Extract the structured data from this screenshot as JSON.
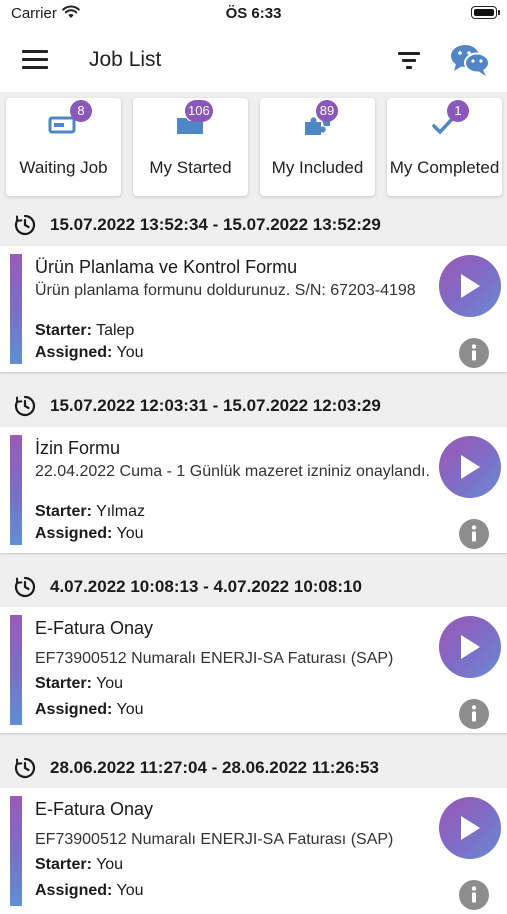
{
  "status_bar": {
    "carrier": "Carrier",
    "time": "ÖS 6:33"
  },
  "header": {
    "title": "Job List"
  },
  "tiles": [
    {
      "label": "Waiting Job",
      "badge": "8",
      "icon": "waiting-job-icon"
    },
    {
      "label": "My Started",
      "badge": "106",
      "icon": "folder-icon"
    },
    {
      "label": "My Included",
      "badge": "89",
      "icon": "puzzle-icon"
    },
    {
      "label": "My Completed",
      "badge": "1",
      "icon": "checkmark-icon"
    }
  ],
  "groups": [
    {
      "date_range": "15.07.2022 13:52:34 - 15.07.2022 13:52:29",
      "job": {
        "title": "Ürün Planlama ve Kontrol Formu",
        "description": "Ürün planlama formunu doldurunuz. S/N: 67203-4198",
        "starter_label": "Starter:",
        "starter": "Talep",
        "assigned_label": "Assigned:",
        "assigned": "You"
      }
    },
    {
      "date_range": "15.07.2022 12:03:31 - 15.07.2022 12:03:29",
      "job": {
        "title": "İzin Formu",
        "description": "22.04.2022 Cuma - 1 Günlük mazeret izniniz onaylandı.",
        "starter_label": "Starter:",
        "starter": "Yılmaz",
        "assigned_label": "Assigned:",
        "assigned": "You"
      }
    },
    {
      "date_range": "4.07.2022 10:08:13 - 4.07.2022 10:08:10",
      "job": {
        "title": "E-Fatura Onay",
        "description": "EF73900512 Numaralı ENERJI-SA Faturası (SAP)",
        "starter_label": "Starter:",
        "starter": "You",
        "assigned_label": "Assigned:",
        "assigned": "You"
      }
    },
    {
      "date_range": "28.06.2022 11:27:04 - 28.06.2022 11:26:53",
      "job": {
        "title": "E-Fatura Onay",
        "description": "EF73900512 Numaralı ENERJI-SA Faturası (SAP)",
        "starter_label": "Starter:",
        "starter": "You",
        "assigned_label": "Assigned:",
        "assigned": "You"
      }
    }
  ],
  "colors": {
    "accent_purple": "#8a58b8",
    "accent_blue": "#5f8fd4",
    "icon_blue": "#4f86c6",
    "info_gray": "#8d8d8d",
    "background": "#efefef"
  }
}
